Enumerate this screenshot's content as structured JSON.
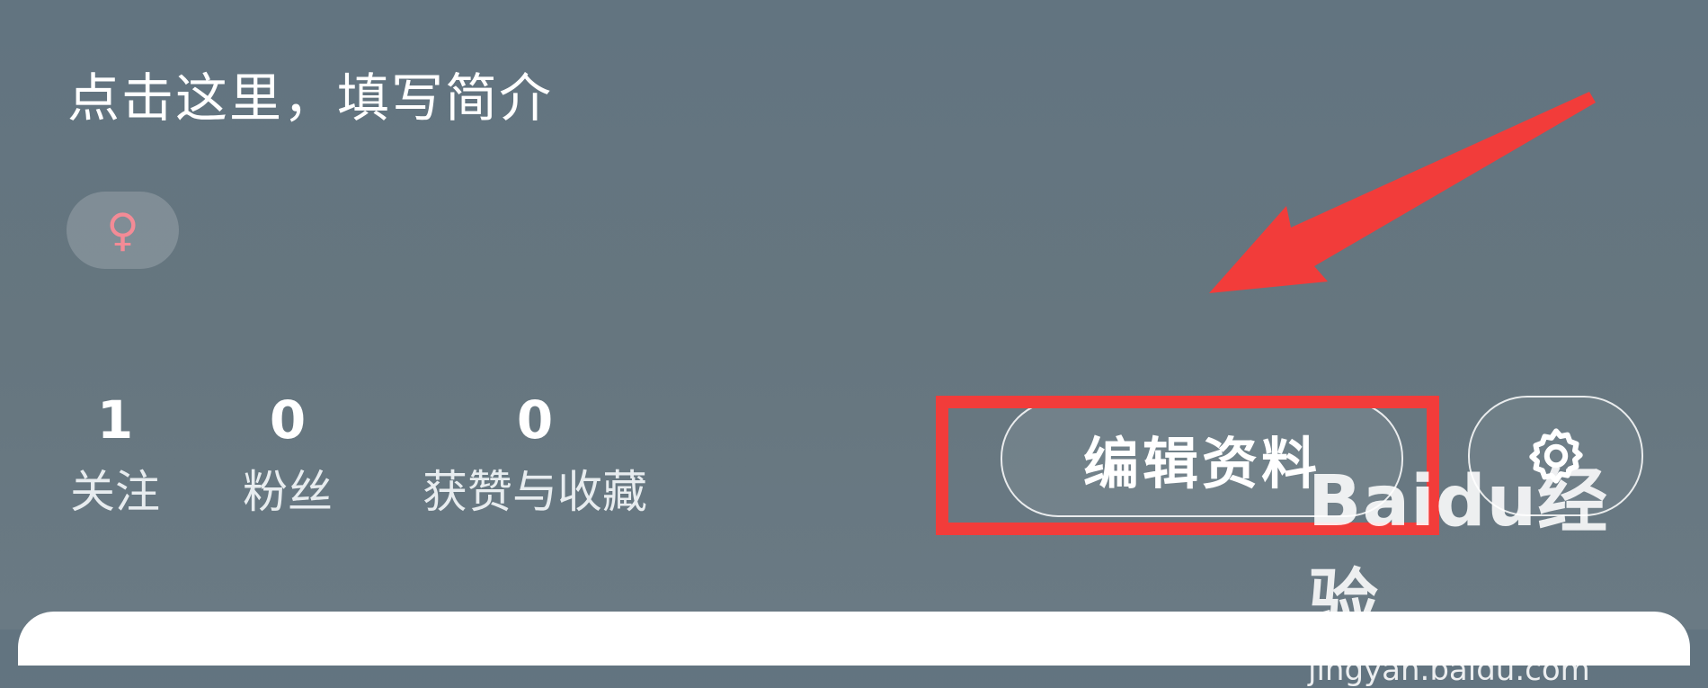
{
  "profile": {
    "bio_prompt": "点击这里，填写简介",
    "gender_symbol": "♀"
  },
  "stats": [
    {
      "value": "1",
      "label": "关注"
    },
    {
      "value": "0",
      "label": "粉丝"
    },
    {
      "value": "0",
      "label": "获赞与收藏"
    }
  ],
  "actions": {
    "edit_profile_label": "编辑资料",
    "settings_icon": "gear-icon"
  },
  "watermark": {
    "logo_text": "Baidu经验",
    "url": "jingyan.baidu.com"
  },
  "colors": {
    "header_bg": "#657782",
    "gender_pink": "#f38b96",
    "annotation_red": "#f23c3a"
  }
}
